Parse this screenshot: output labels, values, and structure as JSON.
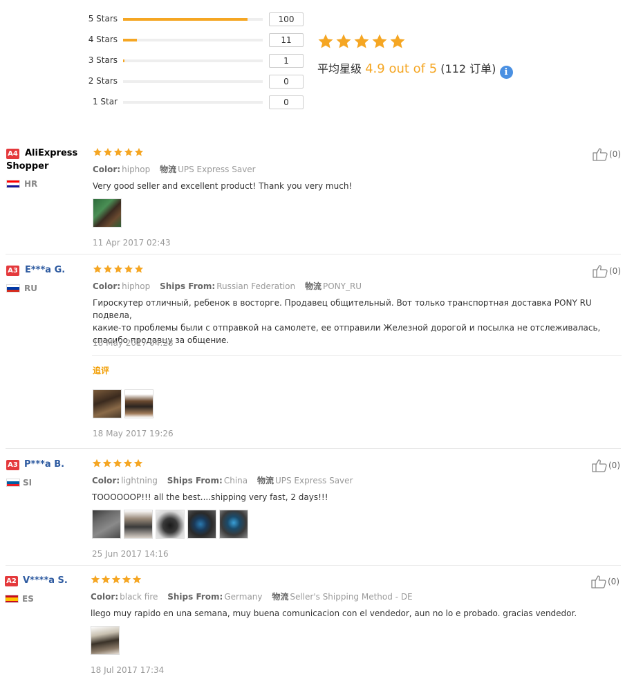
{
  "histogram": [
    {
      "label": "5 Stars",
      "count": "100",
      "fraction": 0.89
    },
    {
      "label": "4 Stars",
      "count": "11",
      "fraction": 0.1
    },
    {
      "label": "3 Stars",
      "count": "1",
      "fraction": 0.01
    },
    {
      "label": "2 Stars",
      "count": "0",
      "fraction": 0
    },
    {
      "label": "1 Star",
      "count": "0",
      "fraction": 0
    }
  ],
  "summary": {
    "prefix": "平均星级",
    "score": "4.9 out of 5",
    "orders": "(112 订单)",
    "stars": 5,
    "info_icon": "info-icon"
  },
  "colors": {
    "star": "#f5a623",
    "accent_orange": "#f29d00",
    "badge_red": "#e4393c",
    "link_blue": "#2d5aa0"
  },
  "reviews": [
    {
      "badge": "A4",
      "name": "AliExpress Shopper",
      "country": "HR",
      "stars": 5,
      "meta": [
        {
          "label": "Color:",
          "value": "hiphop"
        },
        {
          "label": "物流",
          "value": "UPS Express Saver"
        }
      ],
      "text": "Very good seller and excellent product! Thank you very much!",
      "date": "11 Apr 2017 02:43",
      "helpful": "(0)"
    },
    {
      "badge": "A3",
      "name": "E***a G.",
      "country": "RU",
      "stars": 5,
      "meta": [
        {
          "label": "Color:",
          "value": "hiphop"
        },
        {
          "label": "Ships From:",
          "value": "Russian Federation"
        },
        {
          "label": "物流",
          "value": "PONY_RU"
        }
      ],
      "text_lines": [
        "Гироскутер отличный, ребенок в восторге. Продавец общительный. Вот только транспортная доставка PONY RU подвела,",
        "какие-то проблемы были с отправкой на самолете, ее отправили Железной дорогой и посылка не отслеживалась,",
        "спасибо продавцу за общение."
      ],
      "date": "18 May 2017 04:28",
      "followup_label": "追评",
      "followup_date": "18 May 2017 19:26",
      "helpful": "(0)"
    },
    {
      "badge": "A3",
      "name": "P***a B.",
      "country": "SI",
      "stars": 5,
      "meta": [
        {
          "label": "Color:",
          "value": "lightning"
        },
        {
          "label": "Ships From:",
          "value": "China"
        },
        {
          "label": "物流",
          "value": "UPS Express Saver"
        }
      ],
      "text": "TOOOOOOP!!! all the best....shipping very fast, 2 days!!!",
      "date": "25 Jun 2017 14:16",
      "helpful": "(0)"
    },
    {
      "badge": "A2",
      "name": "V****a S.",
      "country": "ES",
      "stars": 5,
      "meta": [
        {
          "label": "Color:",
          "value": "black fire"
        },
        {
          "label": "Ships From:",
          "value": "Germany"
        },
        {
          "label": "物流",
          "value": "Seller's Shipping Method - DE"
        }
      ],
      "text": "llego muy rapido en una semana, muy buena comunicacion con el vendedor, aun no lo e probado. gracias vendedor.",
      "date": "18 Jul 2017 17:34",
      "helpful": "(0)"
    }
  ]
}
